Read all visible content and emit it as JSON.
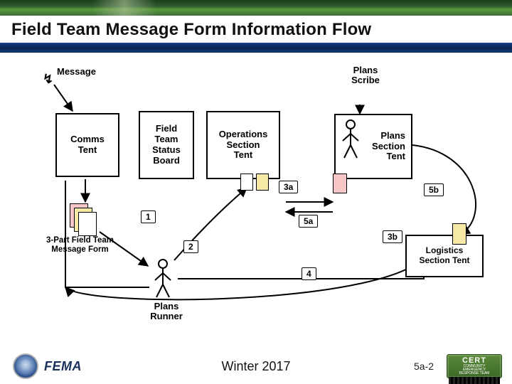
{
  "slide": {
    "title": "Field Team Message Form Information Flow"
  },
  "diagram": {
    "message_label": "Message",
    "boxes": {
      "comms_tent": "Comms\nTent",
      "field_team_status_board": "Field\nTeam\nStatus\nBoard",
      "operations_section_tent": "Operations\nSection\nTent",
      "plans_section_tent": "Plans\nSection\nTent",
      "logistics_section_tent": "Logistics\nSection Tent"
    },
    "external_labels": {
      "plans_scribe": "Plans\nScribe",
      "three_part_form": "3-Part\nField Team\nMessage Form",
      "plans_runner": "Plans\nRunner"
    },
    "step_numbers": {
      "s1": "1",
      "s2": "2",
      "s3a": "3a",
      "s3b": "3b",
      "s4": "4",
      "s5a": "5a",
      "s5b": "5b"
    }
  },
  "footer": {
    "agency": "FEMA",
    "term": "Winter 2017",
    "page": "5a-2",
    "badge_top": "CERT",
    "badge_sub": "COMMUNITY\nEMERGENCY\nRESPONSE TEAM"
  }
}
